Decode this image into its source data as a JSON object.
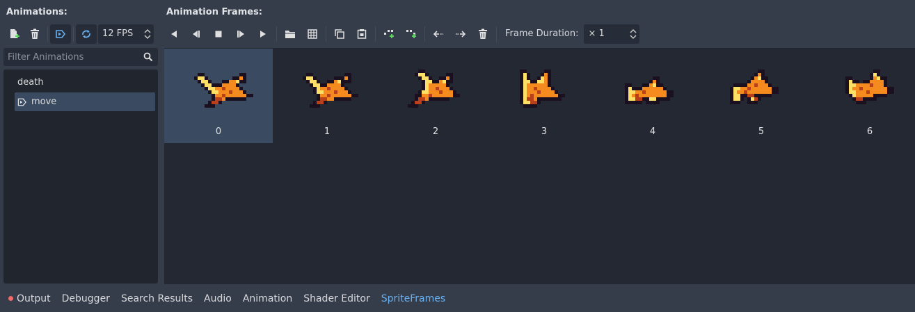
{
  "left": {
    "title": "Animations:",
    "fps": "12 FPS",
    "filter_placeholder": "Filter Animations",
    "animations": [
      {
        "name": "death",
        "selected": false
      },
      {
        "name": "move",
        "selected": true
      }
    ]
  },
  "right": {
    "title": "Animation Frames:",
    "frame_duration_label": "Frame Duration:",
    "frame_duration_value": "× 1"
  },
  "frames": [
    {
      "label": "0",
      "selected": true
    },
    {
      "label": "1",
      "selected": false
    },
    {
      "label": "2",
      "selected": false
    },
    {
      "label": "3",
      "selected": false
    },
    {
      "label": "4",
      "selected": false
    },
    {
      "label": "5",
      "selected": false
    },
    {
      "label": "6",
      "selected": false
    }
  ],
  "bottom_tabs": [
    {
      "label": "Output",
      "active": false
    },
    {
      "label": "Debugger",
      "active": false
    },
    {
      "label": "Search Results",
      "active": false
    },
    {
      "label": "Audio",
      "active": false
    },
    {
      "label": "Animation",
      "active": false
    },
    {
      "label": "Shader Editor",
      "active": false
    },
    {
      "label": "SpriteFrames",
      "active": true
    }
  ],
  "colors": {
    "accent": "#68b0f0",
    "selection": "#3a4b61",
    "panel_bg": "#363d4a",
    "list_bg": "#20252e",
    "error_dot": "#f26b6b",
    "sprite_dark": "#1a1020",
    "sprite_yellow": "#ffe066",
    "sprite_orange": "#f58a1f",
    "sprite_red": "#b8411c"
  }
}
